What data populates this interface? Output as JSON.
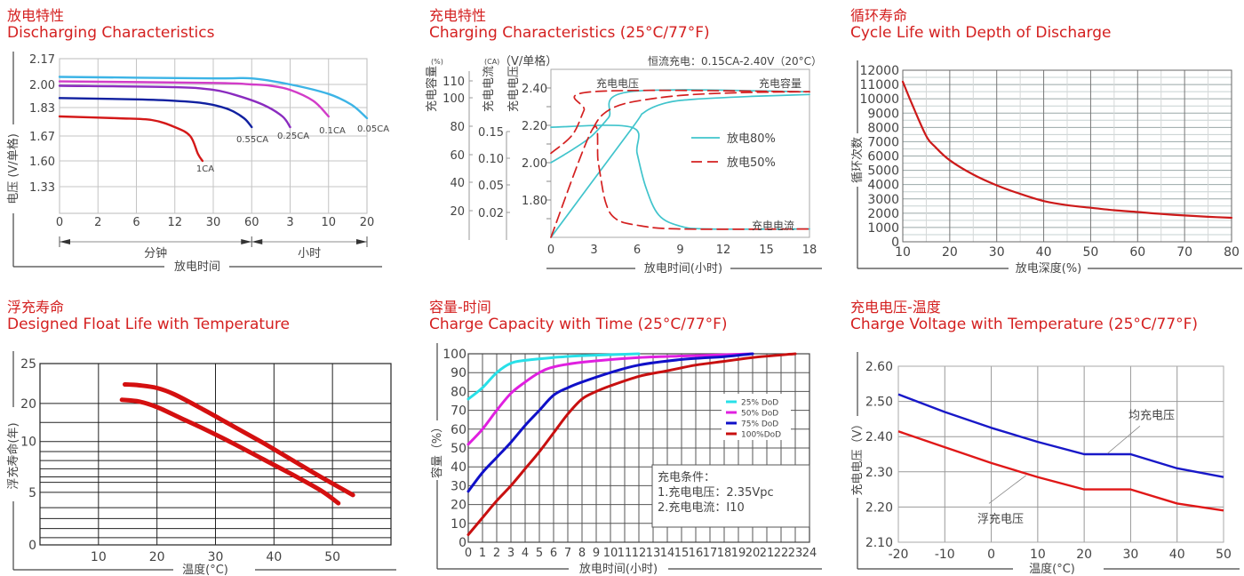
{
  "chart_data": [
    {
      "id": "discharge",
      "type": "line",
      "title_cn": "放电特性",
      "title": "Discharging Characteristics",
      "ylabel": "电压 (V/单格)",
      "xlabel": "放电时间",
      "y_ticks": [
        "2.17",
        "2.00",
        "1.83",
        "1.67",
        "1.60",
        "1.33"
      ],
      "x_ticks": [
        "0",
        "2",
        "6",
        "12",
        "30",
        "60",
        "3",
        "10",
        "20"
      ],
      "x_groups": [
        {
          "label": "分钟",
          "from": 0,
          "to": 5
        },
        {
          "label": "小时",
          "from": 5,
          "to": 8
        }
      ],
      "note": "x positions are tick indices on a nonlinear time scale; y values in ytick-index units (0=2.17 top, 6=bottom)",
      "series": [
        {
          "name": "0.05CA",
          "color": "#3cb4e6",
          "points": [
            [
              0,
              2.05
            ],
            [
              4,
              2.04
            ],
            [
              5,
              2.04
            ],
            [
              6,
              2.0
            ],
            [
              7,
              1.93
            ],
            [
              7.6,
              1.85
            ],
            [
              8,
              1.77
            ]
          ]
        },
        {
          "name": "0.1CA",
          "color": "#d23cc8",
          "points": [
            [
              0,
              2.02
            ],
            [
              4,
              2.01
            ],
            [
              5,
              2.0
            ],
            [
              5.5,
              1.99
            ],
            [
              6,
              1.96
            ],
            [
              6.6,
              1.88
            ],
            [
              7,
              1.78
            ]
          ]
        },
        {
          "name": "0.25CA",
          "color": "#8a2bbf",
          "points": [
            [
              0,
              1.99
            ],
            [
              3,
              1.98
            ],
            [
              4,
              1.96
            ],
            [
              4.6,
              1.92
            ],
            [
              5.3,
              1.85
            ],
            [
              5.8,
              1.78
            ],
            [
              6,
              1.72
            ]
          ]
        },
        {
          "name": "0.55CA",
          "color": "#1020a0",
          "points": [
            [
              0,
              1.9
            ],
            [
              2,
              1.89
            ],
            [
              3,
              1.88
            ],
            [
              3.8,
              1.86
            ],
            [
              4.4,
              1.82
            ],
            [
              4.8,
              1.77
            ],
            [
              5,
              1.72
            ]
          ]
        },
        {
          "name": "1CA",
          "color": "#d41818",
          "points": [
            [
              0,
              1.78
            ],
            [
              1.5,
              1.77
            ],
            [
              2.4,
              1.76
            ],
            [
              3,
              1.72
            ],
            [
              3.4,
              1.67
            ],
            [
              3.6,
              1.62
            ],
            [
              3.72,
              1.6
            ]
          ]
        }
      ]
    },
    {
      "id": "charging",
      "type": "line",
      "title_cn": "充电特性",
      "title": "Charging Characteristics (25°C/77°F)",
      "condition": "恒流充电：0.15CA-2.40V（20°C）",
      "unit_labels": [
        "(%)",
        "(CA)",
        "（V/单格）"
      ],
      "axis_names": [
        "充电容量",
        "充电电流",
        "充电电压"
      ],
      "capacity_ticks": [
        "110",
        "100",
        "80",
        "60",
        "40",
        "20"
      ],
      "current_ticks": [
        "0.15",
        "0.10",
        "0.05",
        "0.02"
      ],
      "voltage_ticks": [
        "2.40",
        "2.20",
        "2.00",
        "1.80"
      ],
      "x_ticks": [
        "0",
        "3",
        "6",
        "9",
        "12",
        "15",
        "18"
      ],
      "xlabel": "放电时间(小时)",
      "xlim": [
        0,
        18
      ],
      "voltage_range": [
        1.6,
        2.5
      ],
      "curve_labels": [
        "充电电压",
        "充电容量",
        "充电电流"
      ],
      "legend": [
        {
          "name": "放电80%",
          "color": "#40c4cc",
          "dash": false
        },
        {
          "name": "放电50%",
          "color": "#d42020",
          "dash": true
        }
      ],
      "series": [
        {
          "name": "80% voltage",
          "color": "#40c4cc",
          "dash": false,
          "points": [
            [
              0,
              2.0
            ],
            [
              1.5,
              2.07
            ],
            [
              2.8,
              2.14
            ],
            [
              4,
              2.24
            ],
            [
              5.5,
              2.38
            ],
            [
              18,
              2.38
            ]
          ]
        },
        {
          "name": "80% current",
          "color": "#40c4cc",
          "dash": false,
          "points": [
            [
              0,
              2.19
            ],
            [
              5.6,
              2.19
            ],
            [
              6,
              2.05
            ],
            [
              6.6,
              1.87
            ],
            [
              7.5,
              1.72
            ],
            [
              9,
              1.66
            ],
            [
              11,
              1.645
            ],
            [
              18,
              1.645
            ]
          ]
        },
        {
          "name": "80% capacity",
          "color": "#40c4cc",
          "dash": false,
          "points": [
            [
              0,
              1.6
            ],
            [
              5.6,
              2.18
            ],
            [
              6.5,
              2.27
            ],
            [
              8,
              2.32
            ],
            [
              10,
              2.34
            ],
            [
              14,
              2.355
            ],
            [
              18,
              2.365
            ]
          ]
        },
        {
          "name": "50% voltage",
          "color": "#d42020",
          "dash": true,
          "points": [
            [
              0,
              2.05
            ],
            [
              1.5,
              2.15
            ],
            [
              2.3,
              2.28
            ],
            [
              2.9,
              2.38
            ],
            [
              18,
              2.38
            ]
          ]
        },
        {
          "name": "50% current",
          "color": "#d42020",
          "dash": true,
          "points": [
            [
              0,
              1.6
            ],
            [
              2.9,
              2.18
            ],
            [
              3.3,
              2.0
            ],
            [
              3.8,
              1.79
            ],
            [
              4.5,
              1.7
            ],
            [
              6,
              1.665
            ],
            [
              9,
              1.645
            ],
            [
              18,
              1.645
            ]
          ]
        },
        {
          "name": "50% capacity",
          "color": "#d42020",
          "dash": true,
          "points": [
            [
              2.9,
              2.18
            ],
            [
              3.5,
              2.25
            ],
            [
              4.5,
              2.3
            ],
            [
              6,
              2.33
            ],
            [
              9,
              2.36
            ],
            [
              13,
              2.375
            ],
            [
              18,
              2.38
            ]
          ]
        }
      ]
    },
    {
      "id": "cycle-life",
      "type": "line",
      "title_cn": "循环寿命",
      "title": "Cycle Life with Depth of Discharge",
      "ylabel": "循环次数",
      "xlabel": "放电深度(%)",
      "xlim": [
        10,
        80
      ],
      "ylim": [
        0,
        12000
      ],
      "x_ticks": [
        "10",
        "20",
        "30",
        "40",
        "50",
        "60",
        "70",
        "80"
      ],
      "y_ticks": [
        "12000",
        "11000",
        "10000",
        "9000",
        "8000",
        "7000",
        "6000",
        "5000",
        "4000",
        "3000",
        "2000",
        "1000",
        "0"
      ],
      "series": [
        {
          "name": "cycles",
          "color": "#cc1a1a",
          "points": [
            [
              10,
              11200
            ],
            [
              12,
              9600
            ],
            [
              15,
              7400
            ],
            [
              17,
              6600
            ],
            [
              20,
              5700
            ],
            [
              25,
              4700
            ],
            [
              30,
              3950
            ],
            [
              35,
              3350
            ],
            [
              40,
              2850
            ],
            [
              45,
              2560
            ],
            [
              50,
              2380
            ],
            [
              55,
              2210
            ],
            [
              60,
              2080
            ],
            [
              65,
              1950
            ],
            [
              70,
              1840
            ],
            [
              75,
              1750
            ],
            [
              80,
              1680
            ]
          ]
        }
      ]
    },
    {
      "id": "float-life",
      "type": "line",
      "title_cn": "浮充寿命",
      "title": "Designed Float Life with Temperature",
      "ylabel": "浮充寿命(年)",
      "xlabel": "温度(°C)",
      "x_ticks": [
        "10",
        "20",
        "30",
        "40",
        "50"
      ],
      "y_ticks": [
        "25",
        "20",
        "10",
        "5",
        "0"
      ],
      "note": "y axis is nonuniform; values given in y-position fraction from bottom (0) to top (1)",
      "series": [
        {
          "name": "upper",
          "color": "#d41010",
          "points": [
            [
              14.5,
              0.885
            ],
            [
              17,
              0.88
            ],
            [
              20,
              0.865
            ],
            [
              23,
              0.83
            ],
            [
              28,
              0.745
            ],
            [
              33,
              0.655
            ],
            [
              38,
              0.565
            ],
            [
              43,
              0.47
            ],
            [
              48,
              0.375
            ],
            [
              53.5,
              0.275
            ]
          ]
        },
        {
          "name": "lower",
          "color": "#d41010",
          "points": [
            [
              14,
              0.8
            ],
            [
              17,
              0.79
            ],
            [
              20,
              0.76
            ],
            [
              24,
              0.7
            ],
            [
              28,
              0.64
            ],
            [
              33,
              0.56
            ],
            [
              38,
              0.475
            ],
            [
              43,
              0.39
            ],
            [
              48,
              0.3
            ],
            [
              51,
              0.23
            ]
          ]
        }
      ]
    },
    {
      "id": "charge-capacity",
      "type": "line",
      "title_cn": "容量-时间",
      "title": "Charge Capacity with Time (25°C/77°F)",
      "ylabel": "容量（%）",
      "xlabel": "放电时间(小时)",
      "xlim": [
        0,
        24
      ],
      "ylim": [
        0,
        100
      ],
      "x_ticks": [
        "0",
        "1",
        "2",
        "3",
        "4",
        "5",
        "6",
        "7",
        "8",
        "9",
        "10",
        "11",
        "12",
        "13",
        "14",
        "15",
        "16",
        "17",
        "18",
        "19",
        "20",
        "21",
        "22",
        "23",
        "24"
      ],
      "y_ticks": [
        "100",
        "90",
        "80",
        "70",
        "60",
        "50",
        "40",
        "30",
        "20",
        "10",
        "0"
      ],
      "legend": [
        {
          "name": "25%  DoD",
          "color": "#28e0e8"
        },
        {
          "name": "50%  DoD",
          "color": "#e020e0"
        },
        {
          "name": "75%  DoD",
          "color": "#1010c8"
        },
        {
          "name": "100%DoD",
          "color": "#c81010"
        }
      ],
      "conditions": [
        "充电条件：",
        "1.充电电压：2.35Vpc",
        "2.充电电流：I10"
      ],
      "series": [
        {
          "name": "25% DoD",
          "color": "#28e0e8",
          "points": [
            [
              0,
              76
            ],
            [
              1,
              82
            ],
            [
              2,
              90
            ],
            [
              3,
              95
            ],
            [
              4,
              96.5
            ],
            [
              6,
              98
            ],
            [
              8,
              99
            ],
            [
              12,
              100
            ]
          ]
        },
        {
          "name": "50% DoD",
          "color": "#e020e0",
          "points": [
            [
              0,
              52
            ],
            [
              1,
              60
            ],
            [
              2,
              70
            ],
            [
              3,
              79
            ],
            [
              4,
              85
            ],
            [
              5,
              90
            ],
            [
              6,
              93
            ],
            [
              8,
              95.5
            ],
            [
              12,
              98
            ],
            [
              16,
              99
            ],
            [
              20,
              100
            ]
          ]
        },
        {
          "name": "75% DoD",
          "color": "#1010c8",
          "points": [
            [
              0,
              27
            ],
            [
              1,
              37
            ],
            [
              2,
              45
            ],
            [
              3,
              53
            ],
            [
              4,
              62
            ],
            [
              5,
              70
            ],
            [
              6,
              78
            ],
            [
              7,
              82
            ],
            [
              8,
              85
            ],
            [
              10,
              90
            ],
            [
              12,
              94
            ],
            [
              15,
              97
            ],
            [
              18,
              98.5
            ],
            [
              20,
              100
            ]
          ]
        },
        {
          "name": "100%DoD",
          "color": "#c81010",
          "points": [
            [
              0,
              4
            ],
            [
              1,
              13
            ],
            [
              2,
              22
            ],
            [
              3,
              30
            ],
            [
              4,
              39
            ],
            [
              5,
              48
            ],
            [
              6,
              58
            ],
            [
              7,
              68
            ],
            [
              8,
              76
            ],
            [
              9,
              80
            ],
            [
              10,
              83
            ],
            [
              12,
              88
            ],
            [
              14,
              91
            ],
            [
              16,
              94
            ],
            [
              18,
              96
            ],
            [
              20,
              98
            ],
            [
              23,
              100
            ]
          ]
        }
      ]
    },
    {
      "id": "charge-voltage",
      "type": "line",
      "title_cn": "充电电压-温度",
      "title": "Charge Voltage with Temperature (25°C/77°F)",
      "ylabel": "充电电压（V）",
      "xlabel": "温度(°C)",
      "xlim": [
        -20,
        50
      ],
      "ylim": [
        2.1,
        2.6
      ],
      "x_ticks": [
        "-20",
        "-10",
        "0",
        "10",
        "20",
        "30",
        "40",
        "50"
      ],
      "y_ticks": [
        "2.60",
        "2.50",
        "2.40",
        "2.30",
        "2.20",
        "2.10"
      ],
      "series": [
        {
          "name": "均充电压",
          "color": "#1818c8",
          "points": [
            [
              -20,
              2.52
            ],
            [
              -10,
              2.47
            ],
            [
              0,
              2.425
            ],
            [
              10,
              2.385
            ],
            [
              20,
              2.35
            ],
            [
              30,
              2.35
            ],
            [
              40,
              2.31
            ],
            [
              50,
              2.285
            ]
          ]
        },
        {
          "name": "浮充电压",
          "color": "#e01818",
          "points": [
            [
              -20,
              2.415
            ],
            [
              -10,
              2.37
            ],
            [
              0,
              2.325
            ],
            [
              10,
              2.285
            ],
            [
              20,
              2.25
            ],
            [
              30,
              2.25
            ],
            [
              40,
              2.21
            ],
            [
              50,
              2.19
            ]
          ]
        }
      ],
      "annotations": [
        {
          "text": "均充电压",
          "color": "#1818c8"
        },
        {
          "text": "浮充电压",
          "color": "#e01818"
        }
      ]
    }
  ]
}
